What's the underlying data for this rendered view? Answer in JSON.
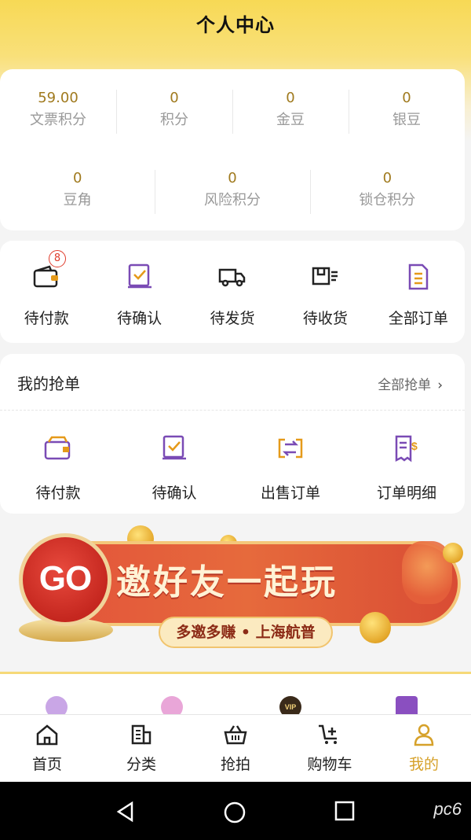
{
  "header": {
    "title": "个人中心"
  },
  "points": {
    "row1": [
      {
        "value": "59.00",
        "label": "文票积分"
      },
      {
        "value": "0",
        "label": "积分"
      },
      {
        "value": "0",
        "label": "金豆"
      },
      {
        "value": "0",
        "label": "银豆"
      }
    ],
    "row2": [
      {
        "value": "0",
        "label": "豆角"
      },
      {
        "value": "0",
        "label": "风险积分"
      },
      {
        "value": "0",
        "label": "锁仓积分"
      }
    ]
  },
  "orders": {
    "items": [
      {
        "label": "待付款",
        "badge": "8",
        "icon": "wallet-icon"
      },
      {
        "label": "待确认",
        "icon": "confirm-doc-icon"
      },
      {
        "label": "待发货",
        "icon": "truck-icon"
      },
      {
        "label": "待收货",
        "icon": "package-icon"
      },
      {
        "label": "全部订单",
        "icon": "order-list-icon"
      }
    ]
  },
  "grab": {
    "title": "我的抢单",
    "all_label": "全部抢单",
    "items": [
      {
        "label": "待付款",
        "icon": "wallet-icon"
      },
      {
        "label": "待确认",
        "icon": "confirm-doc-icon"
      },
      {
        "label": "出售订单",
        "icon": "exchange-icon"
      },
      {
        "label": "订单明细",
        "icon": "bill-detail-icon"
      }
    ]
  },
  "banner": {
    "go_text": "GO",
    "headline": "邀好友一起玩",
    "subline": "多邀多赚 • 上海航普"
  },
  "services": {
    "badge_text": "VIP"
  },
  "bottom_nav": {
    "items": [
      {
        "label": "首页",
        "icon": "home-icon"
      },
      {
        "label": "分类",
        "icon": "category-icon"
      },
      {
        "label": "抢拍",
        "icon": "basket-icon"
      },
      {
        "label": "购物车",
        "icon": "cart-icon"
      },
      {
        "label": "我的",
        "icon": "profile-icon",
        "active": true
      }
    ]
  },
  "watermark": "pc6",
  "colors": {
    "accent": "#f7d955",
    "active": "#d6a12a",
    "icon_purple": "#7a4bb5",
    "icon_orange": "#e59a1a",
    "badge_red": "#e03c2c"
  }
}
